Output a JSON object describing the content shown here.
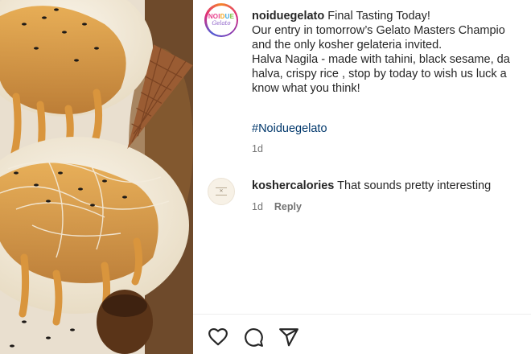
{
  "post": {
    "username": "noiduegelato",
    "caption_lines": [
      "Final Tasting Today!",
      "Our entry in tomorrow’s Gelato Masters Champio",
      "and the only kosher gelateria invited.",
      "Halva Nagila - made with tahini, black sesame, da",
      "halva, crispy rice , stop by today to wish us luck a",
      "know what you think!"
    ],
    "hashtag": "#Noiduegelato",
    "time": "1d"
  },
  "avatar_logo": {
    "line1_parts": [
      "NOI",
      "D",
      "U",
      "E"
    ],
    "line2": "Gelato"
  },
  "comment": {
    "username": "koshercalories",
    "text": "That sounds pretty interesting",
    "time": "1d",
    "reply_label": "Reply"
  },
  "actions": [
    {
      "name": "like-button",
      "icon": "heart-icon"
    },
    {
      "name": "comment-button",
      "icon": "comment-icon"
    },
    {
      "name": "share-button",
      "icon": "paper-plane-icon"
    }
  ],
  "colors": {
    "text": "#262626",
    "muted": "#737373",
    "hashtag": "#00376b",
    "divider": "#efefef"
  }
}
